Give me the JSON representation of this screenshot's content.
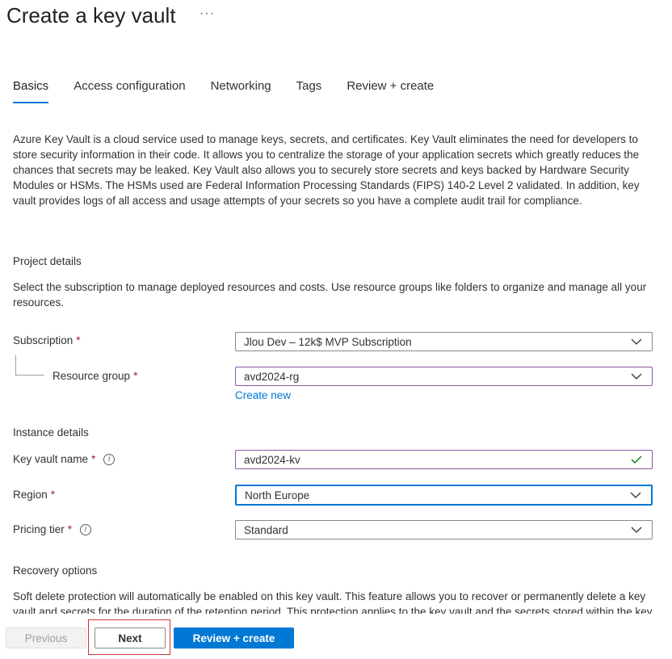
{
  "header": {
    "title": "Create a key vault",
    "more": "···"
  },
  "tabs": [
    {
      "label": "Basics",
      "active": true
    },
    {
      "label": "Access configuration",
      "active": false
    },
    {
      "label": "Networking",
      "active": false
    },
    {
      "label": "Tags",
      "active": false
    },
    {
      "label": "Review + create",
      "active": false
    }
  ],
  "intro": "Azure Key Vault is a cloud service used to manage keys, secrets, and certificates. Key Vault eliminates the need for developers to store security information in their code. It allows you to centralize the storage of your application secrets which greatly reduces the chances that secrets may be leaked. Key Vault also allows you to securely store secrets and keys backed by Hardware Security Modules or HSMs. The HSMs used are Federal Information Processing Standards (FIPS) 140-2 Level 2 validated. In addition, key vault provides logs of all access and usage attempts of your secrets so you have a complete audit trail for compliance.",
  "project": {
    "heading": "Project details",
    "description": "Select the subscription to manage deployed resources and costs. Use resource groups like folders to organize and manage all your resources.",
    "subscription": {
      "label": "Subscription",
      "required": "*",
      "value": "Jlou Dev – 12k$ MVP Subscription"
    },
    "resource_group": {
      "label": "Resource group",
      "required": "*",
      "value": "avd2024-rg",
      "create_new": "Create new"
    }
  },
  "instance": {
    "heading": "Instance details",
    "key_vault_name": {
      "label": "Key vault name",
      "required": "*",
      "value": "avd2024-kv"
    },
    "region": {
      "label": "Region",
      "required": "*",
      "value": "North Europe"
    },
    "pricing_tier": {
      "label": "Pricing tier",
      "required": "*",
      "value": "Standard"
    }
  },
  "recovery": {
    "heading": "Recovery options",
    "description": "Soft delete protection will automatically be enabled on this key vault. This feature allows you to recover or permanently delete a key vault and secrets for the duration of the retention period. This protection applies to the key vault and the secrets stored within the key vault."
  },
  "footer": {
    "previous": "Previous",
    "next": "Next",
    "review_create": "Review + create"
  },
  "colors": {
    "accent": "#0078d4",
    "required": "#a4262c",
    "valid": "#107c10",
    "highlight": "#d13438"
  }
}
